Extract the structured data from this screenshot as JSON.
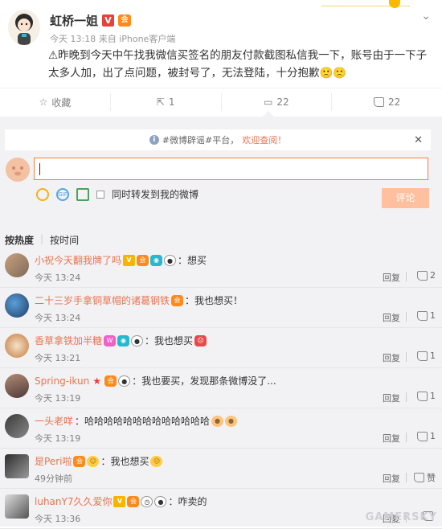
{
  "post": {
    "author": "虹桥一姐",
    "verified_badge": "V",
    "crown_badge": "会",
    "time": "今天 13:18",
    "source": "来自 iPhone客户端",
    "content": "⚠昨晚到今天中午找我微信买签名的朋友付款截图私信我一下，账号由于一下子太多人加，出了点问题，被封号了，无法登陆，十分抱歉🙁🙁"
  },
  "actions": {
    "favorite": "收藏",
    "repost_count": "1",
    "comment_count": "22",
    "like_count": "22"
  },
  "notice": {
    "prefix": "#微博辟谣#平台，",
    "link": "欢迎查阅！"
  },
  "composer": {
    "repost_option": "同时转发到我的微博",
    "submit_label": "评论"
  },
  "sort": {
    "hot": "按热度",
    "time": "按时间"
  },
  "comments": [
    {
      "name": "小祝今天翻我牌了吗",
      "text": "：想买",
      "time": "今天 13:24",
      "reply": "回复",
      "likes": "2"
    },
    {
      "name": "二十三岁手拿铜草帽的诸葛钢铁",
      "text": "：我也想买！",
      "time": "今天 13:24",
      "reply": "回复",
      "likes": "1"
    },
    {
      "name": "香草拿铁加半糖",
      "text": "：我也想买",
      "time": "今天 13:21",
      "reply": "回复",
      "likes": "1"
    },
    {
      "name": "Spring-ikun",
      "text": "：我也要买，发现那条微博没了...",
      "time": "今天 13:19",
      "reply": "回复",
      "likes": "1"
    },
    {
      "name": "一头老咩",
      "text": "：哈哈哈哈哈哈哈哈哈哈哈哈哈",
      "time": "今天 13:19",
      "reply": "回复",
      "likes": "1"
    },
    {
      "name": "是Peri啦",
      "text": "：我也想买",
      "time": "49分钟前",
      "reply": "回复",
      "likes": "赞"
    },
    {
      "name": "luhanY7久久爱你",
      "text": "：咋卖的",
      "time": "今天 13:36",
      "reply": "回复",
      "likes": ""
    }
  ],
  "watermark": "GAMERSKY",
  "colors": {
    "accent": "#eb7350",
    "link": "#eb7350",
    "panel": "#f2f2f5"
  }
}
